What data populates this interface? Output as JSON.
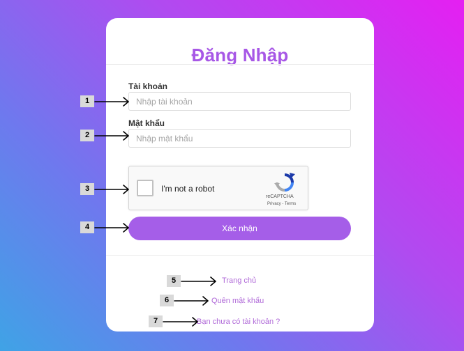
{
  "login": {
    "title": "Đăng Nhập",
    "username_label": "Tài khoản",
    "username_placeholder": "Nhập tài khoản",
    "password_label": "Mật khẩu",
    "password_placeholder": "Nhập mật khẩu",
    "submit_label": "Xác nhận"
  },
  "recaptcha": {
    "label": "I'm not a robot",
    "brand": "reCAPTCHA",
    "terms": "Privacy - Terms"
  },
  "links": {
    "home": "Trang chủ",
    "forgot_password": "Quên mật khẩu",
    "register": "Bạn chưa có tài khoản ?"
  },
  "annotations": {
    "m1": "1",
    "m2": "2",
    "m3": "3",
    "m4": "4",
    "m5": "5",
    "m6": "6",
    "m7": "7"
  },
  "colors": {
    "accent": "#a757e6",
    "button": "#a55ee8",
    "link": "#b06ad8",
    "background_start": "#3fa3e6",
    "background_end": "#e51ff2"
  }
}
